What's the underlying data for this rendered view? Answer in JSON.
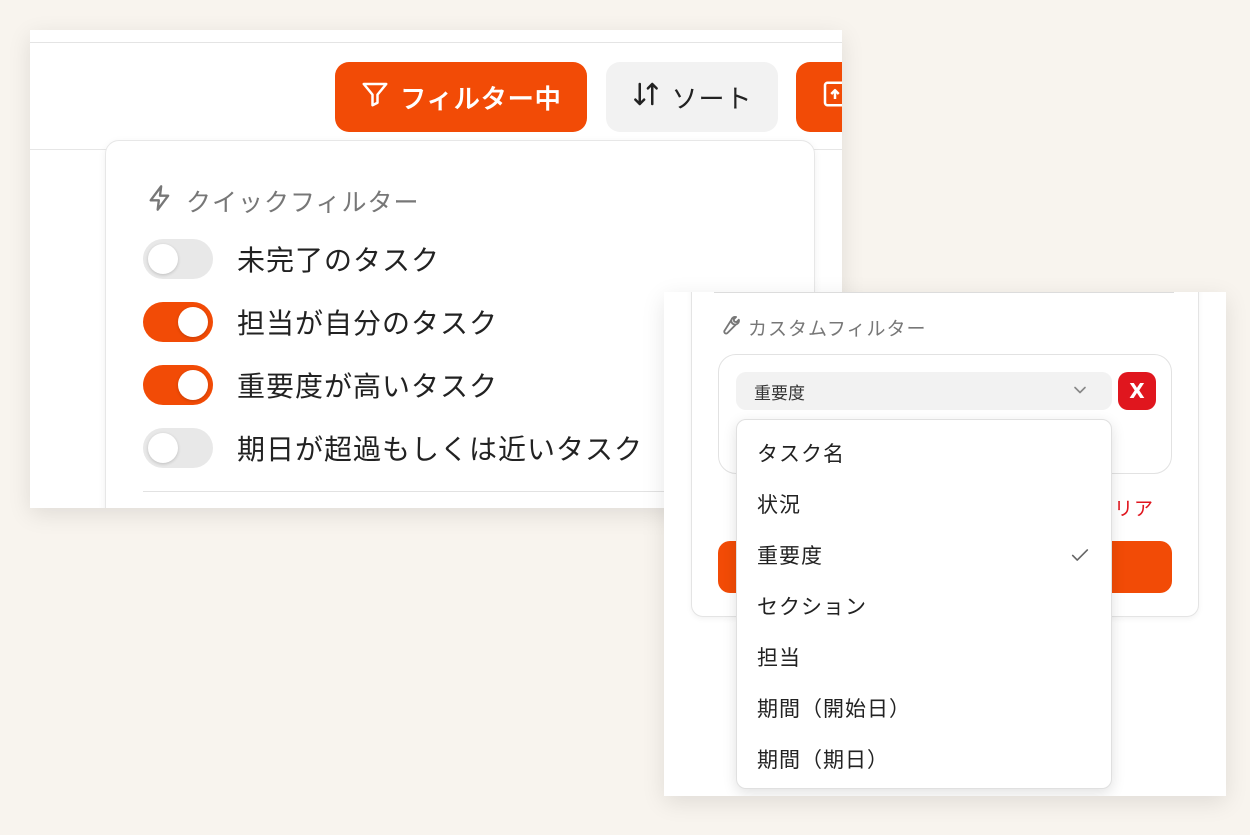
{
  "toolbar": {
    "filter_label": "フィルター中",
    "sort_label": "ソート"
  },
  "quick_filter": {
    "title": "クイックフィルター",
    "items": [
      {
        "label": "未完了のタスク",
        "enabled": false
      },
      {
        "label": "担当が自分のタスク",
        "enabled": true
      },
      {
        "label": "重要度が高いタスク",
        "enabled": true
      },
      {
        "label": "期日が超過もしくは近いタスク",
        "enabled": false
      }
    ]
  },
  "custom_filter": {
    "title": "カスタムフィルター",
    "field_select_value": "重要度",
    "remove_label": "X",
    "clear_label": "リア",
    "options": [
      {
        "label": "タスク名",
        "selected": false
      },
      {
        "label": "状況",
        "selected": false
      },
      {
        "label": "重要度",
        "selected": true
      },
      {
        "label": "セクション",
        "selected": false
      },
      {
        "label": "担当",
        "selected": false
      },
      {
        "label": "期間（開始日）",
        "selected": false
      },
      {
        "label": "期間（期日）",
        "selected": false
      }
    ]
  },
  "colors": {
    "accent": "#f24b06",
    "danger": "#e0161e",
    "background": "#f8f4ee"
  }
}
